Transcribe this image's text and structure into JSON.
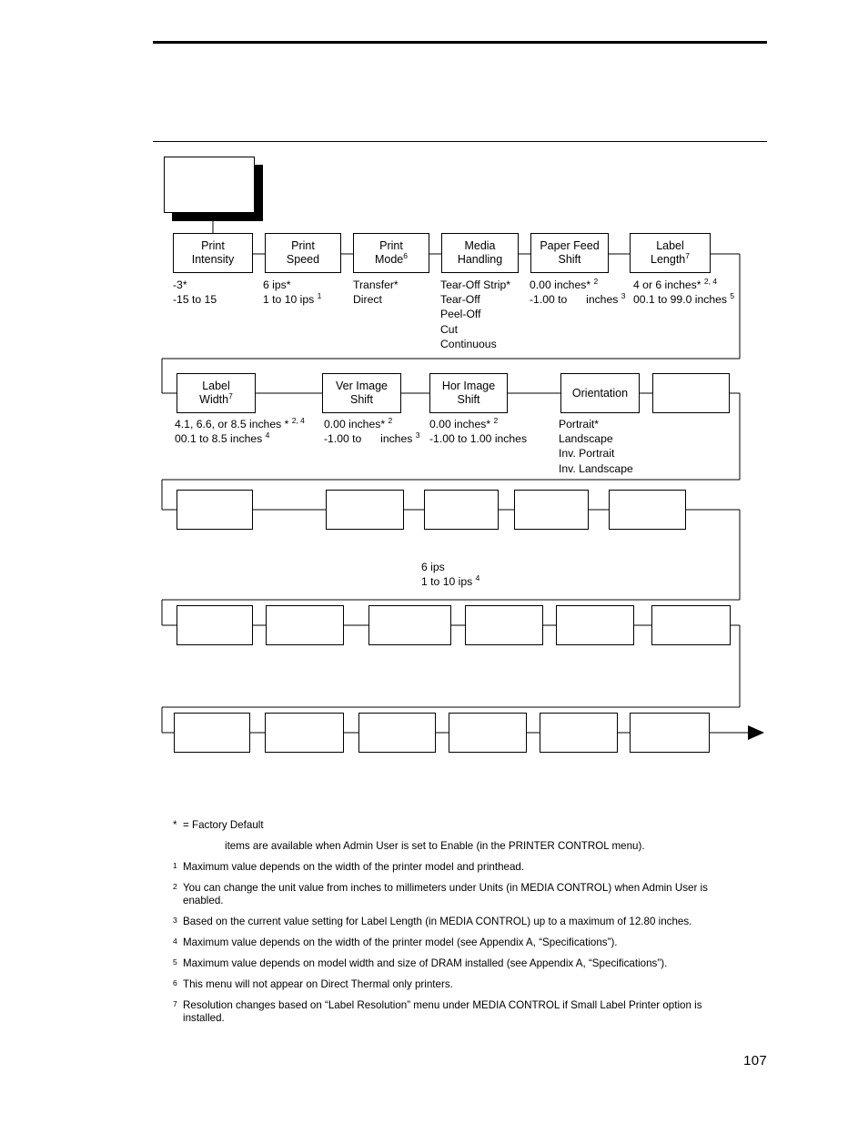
{
  "page": {
    "number": "107"
  },
  "diagram": {
    "title_box_label": "",
    "rows": [
      {
        "id": "row-1",
        "nodes": [
          {
            "name": "print-intensity",
            "line1": "Print",
            "line2": "Intensity",
            "sup": ""
          },
          {
            "name": "print-speed",
            "line1": "Print",
            "line2": "Speed",
            "sup": ""
          },
          {
            "name": "print-mode",
            "line1": "Print",
            "line2": "Mode",
            "sup": "6"
          },
          {
            "name": "media-handling",
            "line1": "Media",
            "line2": "Handling",
            "sup": ""
          },
          {
            "name": "paper-feed-shift",
            "line1": "Paper Feed",
            "line2": "Shift",
            "sup": ""
          },
          {
            "name": "label-length",
            "line1": "Label",
            "line2": "Length",
            "sup": "7"
          }
        ],
        "values": [
          {
            "name": "print-intensity-values",
            "lines": [
              "-3*",
              "-15 to 15"
            ]
          },
          {
            "name": "print-speed-values",
            "lines": [
              "6 ips*",
              "1 to 10 ips |1"
            ]
          },
          {
            "name": "print-mode-values",
            "lines": [
              "Transfer*",
              "Direct"
            ]
          },
          {
            "name": "media-handling-values",
            "lines": [
              "Tear-Off Strip*",
              "Tear-Off",
              "Peel-Off",
              "Cut",
              "Continuous"
            ]
          },
          {
            "name": "paper-feed-shift-values",
            "lines": [
              "0.00 inches* |2",
              "-1.00 to @ inches |3"
            ]
          },
          {
            "name": "label-length-values",
            "lines": [
              "4 or 6 inches* |2, 4",
              "00.1 to 99.0 inches |5"
            ]
          }
        ]
      },
      {
        "id": "row-2",
        "nodes": [
          {
            "name": "label-width",
            "line1": "Label",
            "line2": "Width",
            "sup": "7"
          },
          {
            "name": "ver-image-shift",
            "line1": "Ver Image",
            "line2": "Shift",
            "sup": ""
          },
          {
            "name": "hor-image-shift",
            "line1": "Hor Image",
            "line2": "Shift",
            "sup": ""
          },
          {
            "name": "orientation",
            "line1": "Orientation",
            "line2": "",
            "sup": ""
          },
          {
            "name": "blank-node-r2-5",
            "line1": "",
            "line2": "",
            "sup": ""
          }
        ],
        "values": [
          {
            "name": "label-width-values",
            "lines": [
              "4.1, 6.6, or 8.5 inches * |2, 4",
              "00.1 to 8.5 inches |4"
            ]
          },
          {
            "name": "ver-image-shift-values",
            "lines": [
              "0.00 inches* |2",
              "-1.00 to @ inches |3"
            ]
          },
          {
            "name": "hor-image-shift-values",
            "lines": [
              "0.00 inches* |2",
              "-1.00 to 1.00 inches"
            ]
          },
          {
            "name": "orientation-values",
            "lines": [
              "Portrait*",
              "Landscape",
              "Inv. Portrait",
              "Inv. Landscape"
            ]
          }
        ]
      },
      {
        "id": "row-3",
        "nodes": [
          {
            "name": "blank-node-r3-1",
            "line1": "",
            "line2": "",
            "sup": ""
          },
          {
            "name": "blank-node-r3-2",
            "line1": "",
            "line2": "",
            "sup": ""
          },
          {
            "name": "blank-node-r3-3",
            "line1": "",
            "line2": "",
            "sup": ""
          },
          {
            "name": "blank-node-r3-4",
            "line1": "",
            "line2": "",
            "sup": ""
          },
          {
            "name": "blank-node-r3-5",
            "line1": "",
            "line2": "",
            "sup": ""
          }
        ],
        "values": [
          {
            "name": "row3-speed-values",
            "lines": [
              "6 ips",
              "1 to 10 ips |4"
            ]
          }
        ]
      },
      {
        "id": "row-4",
        "nodes": [
          {
            "name": "blank-node-r4-1",
            "line1": "",
            "line2": "",
            "sup": ""
          },
          {
            "name": "blank-node-r4-2",
            "line1": "",
            "line2": "",
            "sup": ""
          },
          {
            "name": "blank-node-r4-3",
            "line1": "",
            "line2": "",
            "sup": ""
          },
          {
            "name": "blank-node-r4-4",
            "line1": "",
            "line2": "",
            "sup": ""
          },
          {
            "name": "blank-node-r4-5",
            "line1": "",
            "line2": "",
            "sup": ""
          },
          {
            "name": "blank-node-r4-6",
            "line1": "",
            "line2": "",
            "sup": ""
          }
        ],
        "values": []
      },
      {
        "id": "row-5",
        "nodes": [
          {
            "name": "blank-node-r5-1",
            "line1": "",
            "line2": "",
            "sup": ""
          },
          {
            "name": "blank-node-r5-2",
            "line1": "",
            "line2": "",
            "sup": ""
          },
          {
            "name": "blank-node-r5-3",
            "line1": "",
            "line2": "",
            "sup": ""
          },
          {
            "name": "blank-node-r5-4",
            "line1": "",
            "line2": "",
            "sup": ""
          },
          {
            "name": "blank-node-r5-5",
            "line1": "",
            "line2": "",
            "sup": ""
          },
          {
            "name": "blank-node-r5-6",
            "line1": "",
            "line2": "",
            "sup": ""
          }
        ],
        "values": []
      }
    ]
  },
  "footnotes": {
    "legend_mark": "*",
    "legend_text": "= Factory Default",
    "admin_text": "items are available when Admin User is set to Enable (in the PRINTER CONTROL menu).",
    "items": [
      {
        "mark": "1",
        "text": "Maximum value depends on the width of the printer model and printhead.",
        "cont": ""
      },
      {
        "mark": "2",
        "text": "You can change the unit value from inches to millimeters under Units (in MEDIA CONTROL) when Admin User is",
        "cont": "enabled."
      },
      {
        "mark": "3",
        "text": "Based on the current value setting for Label Length (in MEDIA CONTROL) up to a maximum of 12.80 inches.",
        "cont": ""
      },
      {
        "mark": "4",
        "text": "Maximum value depends on the width of the printer model (see Appendix A, “Specifications”).",
        "cont": ""
      },
      {
        "mark": "5",
        "text": "Maximum value depends on model width and size of DRAM installed (see Appendix A, “Specifications”).",
        "cont": ""
      },
      {
        "mark": "6",
        "text": "This menu will not appear on Direct Thermal only printers.",
        "cont": ""
      },
      {
        "mark": "7",
        "text": "Resolution changes based on “Label Resolution” menu under MEDIA CONTROL if Small Label Printer option is",
        "cont": "installed."
      }
    ]
  }
}
